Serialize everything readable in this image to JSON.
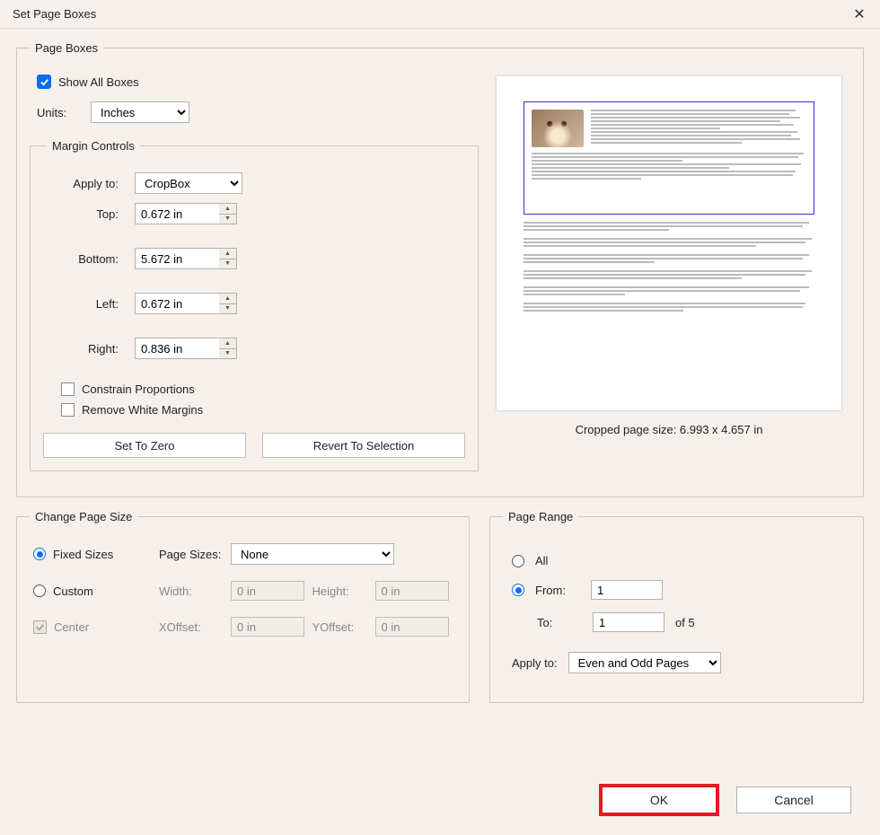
{
  "title": "Set Page Boxes",
  "page_boxes": {
    "legend": "Page Boxes",
    "show_all_boxes_label": "Show All Boxes",
    "units_label": "Units:",
    "units_value": "Inches"
  },
  "margin_controls": {
    "legend": "Margin Controls",
    "apply_to_label": "Apply to:",
    "apply_to_value": "CropBox",
    "top_label": "Top:",
    "top_value": "0.672 in",
    "bottom_label": "Bottom:",
    "bottom_value": "5.672 in",
    "left_label": "Left:",
    "left_value": "0.672 in",
    "right_label": "Right:",
    "right_value": "0.836 in",
    "constrain_label": "Constrain Proportions",
    "remove_white_label": "Remove White Margins",
    "set_zero": "Set To Zero",
    "revert": "Revert To Selection"
  },
  "preview": {
    "caption": "Cropped page size: 6.993 x 4.657 in"
  },
  "change_size": {
    "legend": "Change Page Size",
    "fixed_label": "Fixed Sizes",
    "page_sizes_label": "Page Sizes:",
    "page_sizes_value": "None",
    "custom_label": "Custom",
    "width_label": "Width:",
    "width_value": "0 in",
    "height_label": "Height:",
    "height_value": "0 in",
    "center_label": "Center",
    "xoffset_label": "XOffset:",
    "xoffset_value": "0 in",
    "yoffset_label": "YOffset:",
    "yoffset_value": "0 in"
  },
  "page_range": {
    "legend": "Page Range",
    "all_label": "All",
    "from_label": "From:",
    "from_value": "1",
    "to_label": "To:",
    "to_value": "1",
    "of_label": "of 5",
    "apply_label": "Apply to:",
    "apply_value": "Even and Odd Pages"
  },
  "footer": {
    "ok": "OK",
    "cancel": "Cancel"
  }
}
